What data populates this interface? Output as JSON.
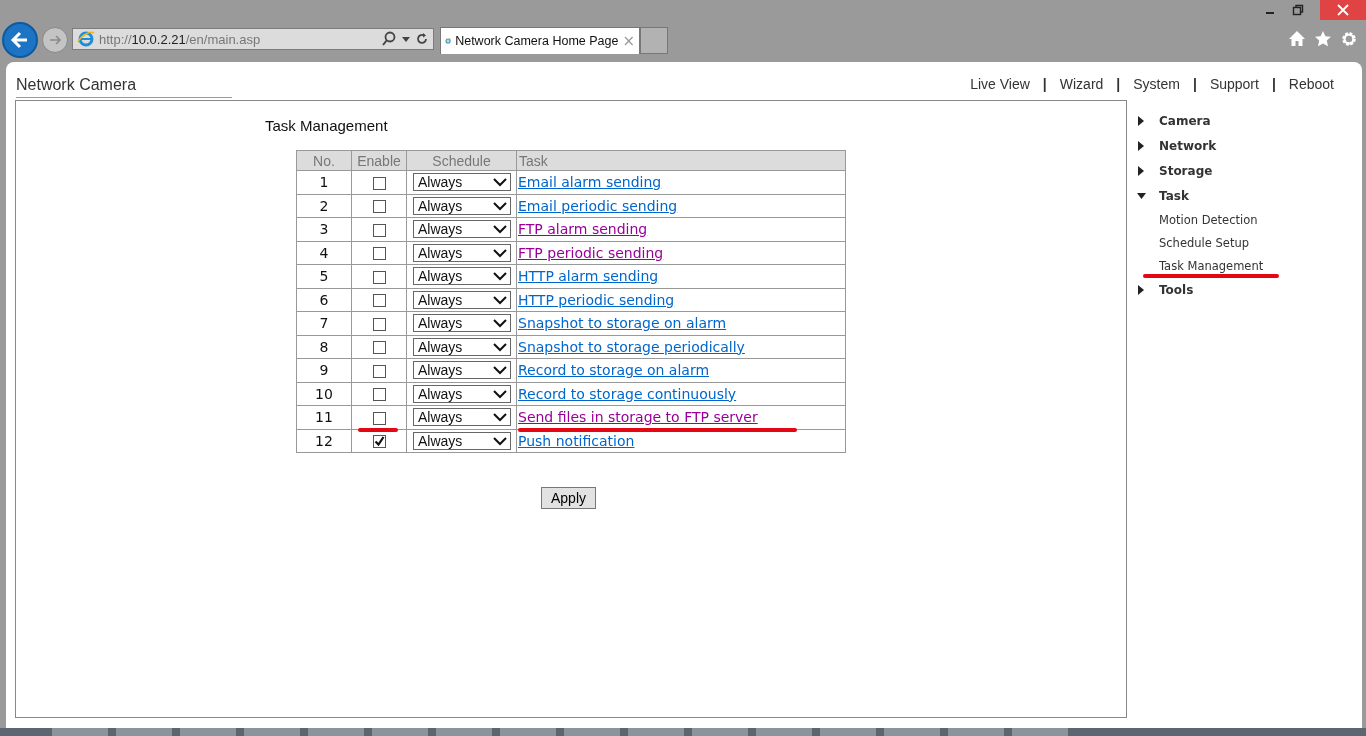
{
  "browser": {
    "address": {
      "prefix": "http://",
      "host": "10.0.2.21",
      "path": "/en/main.asp"
    },
    "tab": {
      "title": "Network Camera Home Page",
      "close": "×"
    }
  },
  "header": {
    "title": "Network Camera",
    "nav": [
      "Live View",
      "Wizard",
      "System",
      "Support",
      "Reboot"
    ],
    "separator": "|"
  },
  "page_title": "Task Management",
  "table": {
    "columns": [
      "No.",
      "Enable",
      "Schedule",
      "Task"
    ],
    "rows": [
      {
        "no": "1",
        "checked": false,
        "schedule": "Always",
        "task": "Email alarm sending",
        "visited": false,
        "marked": false
      },
      {
        "no": "2",
        "checked": false,
        "schedule": "Always",
        "task": "Email periodic sending",
        "visited": false,
        "marked": false
      },
      {
        "no": "3",
        "checked": false,
        "schedule": "Always",
        "task": "FTP alarm sending",
        "visited": true,
        "marked": false
      },
      {
        "no": "4",
        "checked": false,
        "schedule": "Always",
        "task": "FTP periodic sending",
        "visited": true,
        "marked": false
      },
      {
        "no": "5",
        "checked": false,
        "schedule": "Always",
        "task": "HTTP alarm sending",
        "visited": false,
        "marked": false
      },
      {
        "no": "6",
        "checked": false,
        "schedule": "Always",
        "task": "HTTP periodic sending",
        "visited": false,
        "marked": false
      },
      {
        "no": "7",
        "checked": false,
        "schedule": "Always",
        "task": "Snapshot to storage on alarm",
        "visited": false,
        "marked": false
      },
      {
        "no": "8",
        "checked": false,
        "schedule": "Always",
        "task": "Snapshot to storage periodically",
        "visited": false,
        "marked": false
      },
      {
        "no": "9",
        "checked": false,
        "schedule": "Always",
        "task": "Record to storage on alarm",
        "visited": false,
        "marked": false
      },
      {
        "no": "10",
        "checked": false,
        "schedule": "Always",
        "task": "Record to storage continuously",
        "visited": false,
        "marked": false
      },
      {
        "no": "11",
        "checked": false,
        "schedule": "Always",
        "task": "Send files in storage to FTP server",
        "visited": true,
        "marked": true
      },
      {
        "no": "12",
        "checked": true,
        "schedule": "Always",
        "task": "Push notification",
        "visited": false,
        "marked": false
      }
    ]
  },
  "apply_button": "Apply",
  "sidebar": {
    "items": [
      {
        "label": "Camera",
        "expanded": false
      },
      {
        "label": "Network",
        "expanded": false
      },
      {
        "label": "Storage",
        "expanded": false
      },
      {
        "label": "Task",
        "expanded": true,
        "children": [
          {
            "label": "Motion Detection",
            "marked": false
          },
          {
            "label": "Schedule Setup",
            "marked": false
          },
          {
            "label": "Task Management",
            "marked": true
          }
        ]
      },
      {
        "label": "Tools",
        "expanded": false
      }
    ]
  }
}
